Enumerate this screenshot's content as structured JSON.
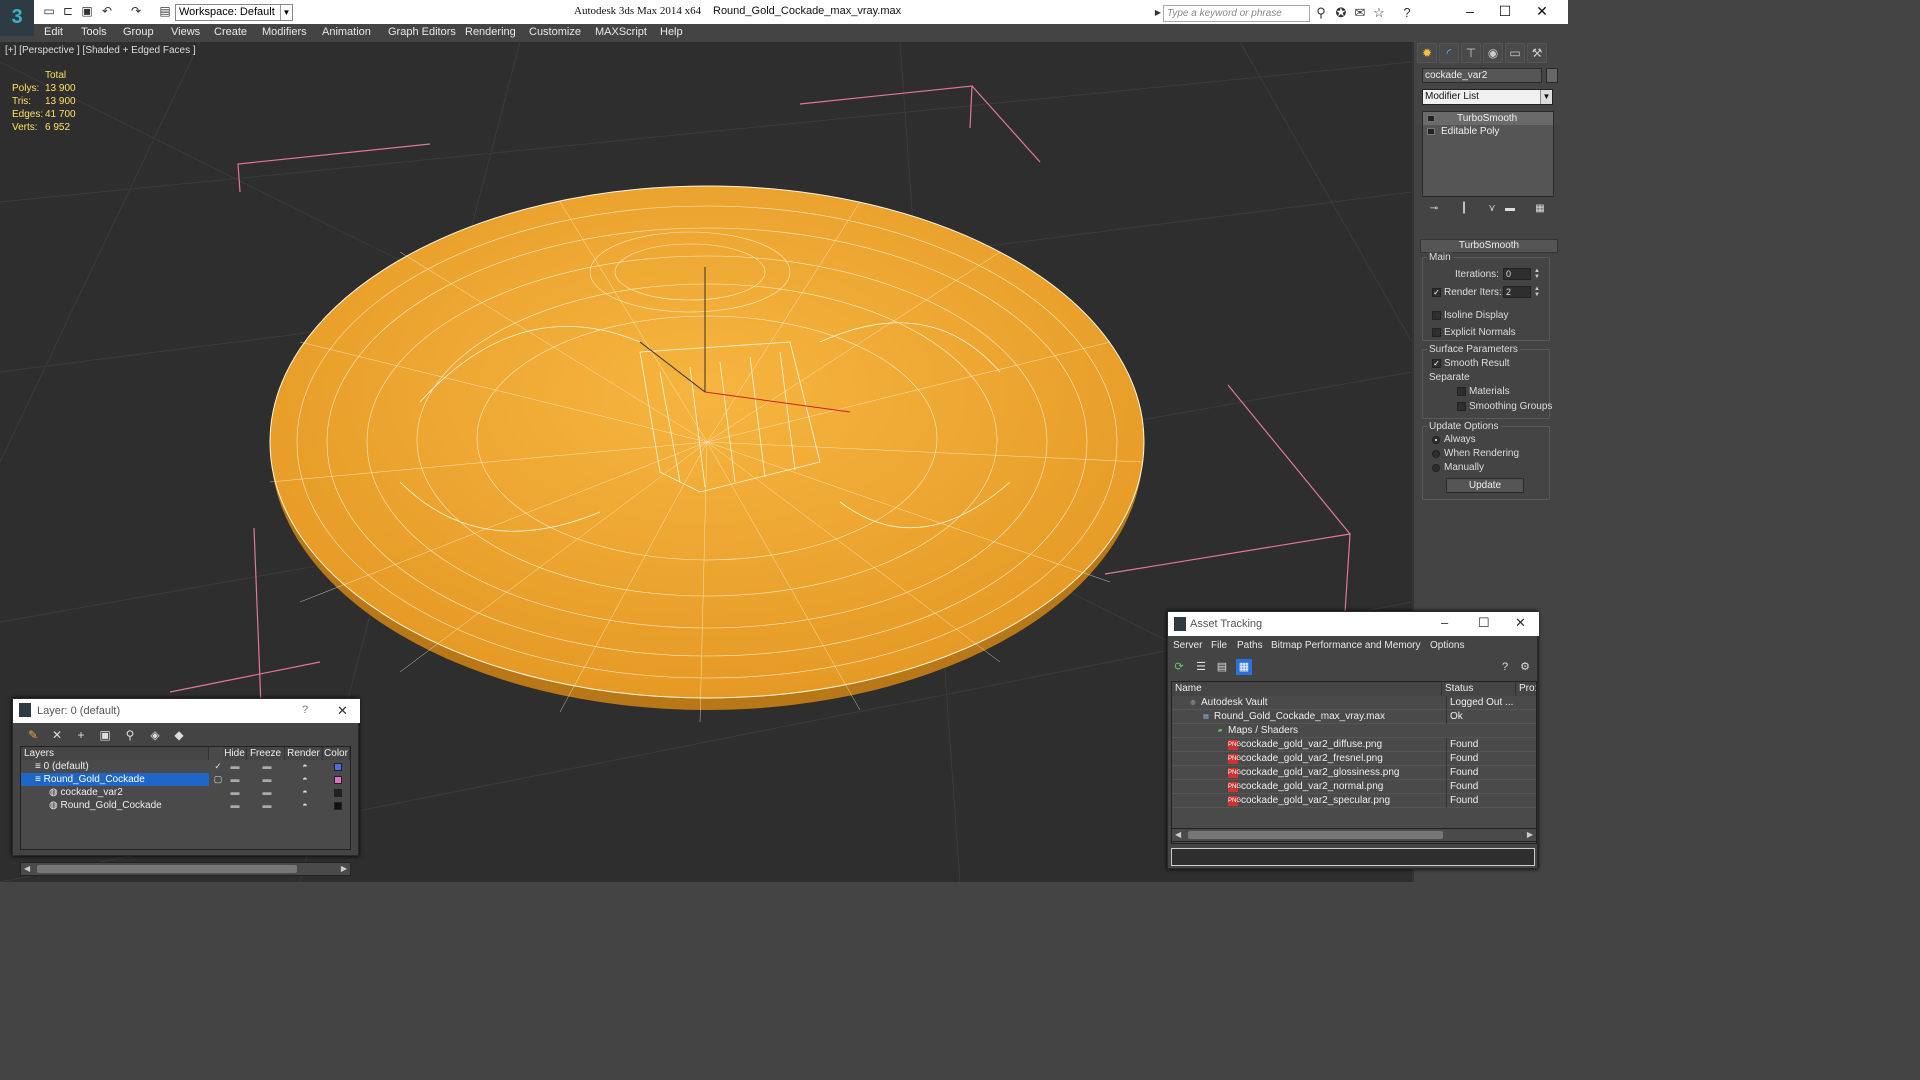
{
  "titlebar": {
    "workspace": "Workspace: Default",
    "app_title": "Autodesk 3ds Max  2014 x64",
    "file_title": "Round_Gold_Cockade_max_vray.max",
    "search_placeholder": "Type a keyword or phrase",
    "minimize": "–",
    "maximize": "☐",
    "close": "✕"
  },
  "menu": [
    "Edit",
    "Tools",
    "Group",
    "Views",
    "Create",
    "Modifiers",
    "Animation",
    "Graph Editors",
    "Rendering",
    "Customize",
    "MAXScript",
    "Help"
  ],
  "viewport": {
    "label": "[+] [Perspective ] [Shaded + Edged Faces ]",
    "stats": {
      "header": "Total",
      "rows": [
        {
          "k": "Polys:",
          "v": "13 900"
        },
        {
          "k": "Tris:",
          "v": "13 900"
        },
        {
          "k": "Edges:",
          "v": "41 700"
        },
        {
          "k": "Verts:",
          "v": "6 952"
        }
      ]
    },
    "object_color": "#f0a830"
  },
  "command_panel": {
    "object_name": "cockade_var2",
    "modifier_list": "Modifier List",
    "stack": [
      "TurboSmooth",
      "Editable Poly"
    ],
    "rollout_title": "TurboSmooth",
    "main_title": "Main",
    "iterations_label": "Iterations:",
    "iterations_value": "0",
    "render_iters_label": "Render Iters:",
    "render_iters_value": "2",
    "isoline": "Isoline Display",
    "explicit_normals": "Explicit Normals",
    "surface_title": "Surface Parameters",
    "smooth_result": "Smooth Result",
    "separate": "Separate",
    "materials": "Materials",
    "smoothing_groups": "Smoothing Groups",
    "update_title": "Update Options",
    "always": "Always",
    "when_rendering": "When Rendering",
    "manually": "Manually",
    "update_button": "Update"
  },
  "layer_window": {
    "title": "Layer: 0 (default)",
    "help": "?",
    "close": "✕",
    "headers": [
      "Layers",
      "Hide",
      "Freeze",
      "Render",
      "Color"
    ],
    "rows": [
      {
        "name": "0 (default)",
        "color": "#4a6fd8"
      },
      {
        "name": "Round_Gold_Cockade",
        "color": "#e070c0"
      },
      {
        "name": "cockade_var2",
        "color": "#222222"
      },
      {
        "name": "Round_Gold_Cockade",
        "color": "#111111"
      }
    ]
  },
  "asset_window": {
    "title": "Asset Tracking",
    "menu": [
      "Server",
      "File",
      "Paths",
      "Bitmap Performance and Memory",
      "Options"
    ],
    "headers": [
      "Name",
      "Status",
      "Pro:"
    ],
    "rows": [
      {
        "name": "Autodesk Vault",
        "status": "Logged Out ..."
      },
      {
        "name": "Round_Gold_Cockade_max_vray.max",
        "status": "Ok"
      },
      {
        "name": "Maps / Shaders",
        "status": ""
      },
      {
        "name": "cockade_gold_var2_diffuse.png",
        "status": "Found"
      },
      {
        "name": "cockade_gold_var2_fresnel.png",
        "status": "Found"
      },
      {
        "name": "cockade_gold_var2_glossiness.png",
        "status": "Found"
      },
      {
        "name": "cockade_gold_var2_normal.png",
        "status": "Found"
      },
      {
        "name": "cockade_gold_var2_specular.png",
        "status": "Found"
      }
    ]
  }
}
